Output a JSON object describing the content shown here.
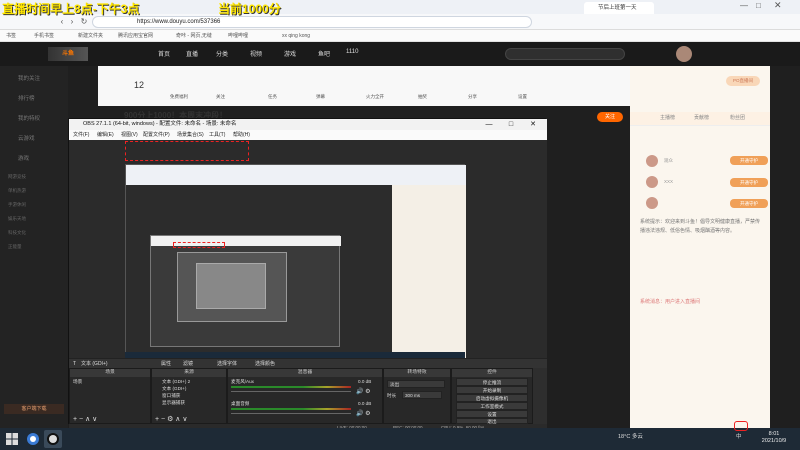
{
  "overlay": {
    "line1": "直播时间早上8点-下午3点",
    "line2": "当前1000分"
  },
  "browser": {
    "url": "https://www.douyu.com/537366",
    "tab_text": "节后上班第一天",
    "bookmarks": [
      "书签",
      "手机书签",
      "新建文件夹",
      "腾讯应用宝官网",
      "奇咔 - 网页,无缝",
      "哔哩哔哩",
      "xx qing kong"
    ]
  },
  "douyu": {
    "logo": "斗鱼",
    "nav": [
      "首页",
      "直播",
      "分类",
      "视频",
      "游戏",
      "鱼吧",
      "1110"
    ],
    "stream_title": "900分上1000！本周末冲段！",
    "follow": "关注",
    "sidebar": [
      "我的关注",
      "排行榜",
      "我的特权",
      "云游戏",
      "游戏",
      "网游竞技",
      "单机热游",
      "手游休闲",
      "娱乐天地",
      "科技文化",
      "正能量"
    ],
    "sidebar_bottom": "客户端下载",
    "toolbar_items": [
      "12",
      "免费福利",
      "关注",
      "任务",
      "弹幕",
      "火力全开",
      "抽奖",
      "分享",
      "设置"
    ]
  },
  "right_panel": {
    "tabs": [
      "主播榜",
      "贡献榜",
      "粉丝团"
    ],
    "ranks": [
      {
        "name": "观众",
        "btn": "开通守护"
      },
      {
        "name": "XXX",
        "btn": "开通守护"
      },
      {
        "name": "",
        "btn": "开通守护"
      }
    ],
    "chat": [
      "系统提示：欢迎来到斗鱼！倡导文明健康直播，严禁传播违法违规、低俗色情、吸烟酗酒等内容。",
      "系统消息：用户进入直播间"
    ],
    "msg_tag": "PO直播间"
  },
  "obs": {
    "title": "OBS 27.1.1 (64-bit, windows) - 配置文件: 未命名 - 场景: 未命名",
    "menu": [
      "文件(F)",
      "编辑(E)",
      "视图(V)",
      "配置文件(P)",
      "场景集合(S)",
      "工具(T)",
      "帮助(H)"
    ],
    "source_bar": {
      "name": "文本 (GDI+)",
      "props": "属性",
      "filters": "滤镜",
      "select": "选择字体",
      "color": "选择颜色"
    },
    "docks": [
      "场景",
      "来源",
      "混音器",
      "转场特效",
      "控件"
    ],
    "scene": "场景",
    "sources": [
      "文本 (GDI+) 2",
      "文本 (GDI+)",
      "窗口捕获",
      "显示器捕获"
    ],
    "mixer": [
      {
        "name": "麦克风/Aux",
        "db": "0.0 dB"
      },
      {
        "name": "桌面音频",
        "db": "0.0 dB"
      }
    ],
    "transition": {
      "type": "淡出",
      "duration_label": "时长",
      "duration": "300 ms"
    },
    "controls": [
      "停止推流",
      "开始录制",
      "启动虚拟摄像机",
      "工作室模式",
      "设置",
      "退出"
    ],
    "status": {
      "live": "LIVE: 00:00:00",
      "rec": "REC: 00:00:00",
      "cpu": "CPU: 0.9%, 60.00 fps"
    }
  },
  "taskbar": {
    "weather": "18°C 多云",
    "time": "8:01",
    "date": "2021/10/9",
    "ime": "中"
  }
}
